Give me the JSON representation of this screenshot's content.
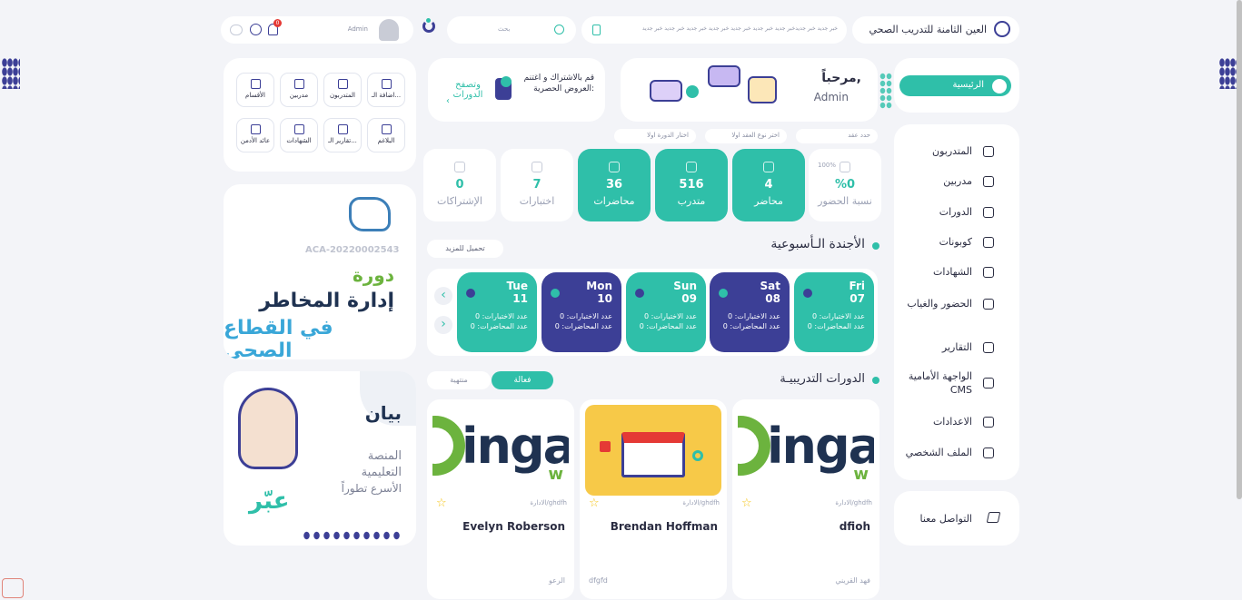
{
  "header": {
    "brand": "العين الثامنة للتدريب الصحي",
    "ticker": "خبر جديد خبر جديدخبر جديد خبر جديد خبر جديد خبر جديد خبر جديد خبر جديد خبر جديد",
    "search_placeholder": "بحث",
    "user": "Admin",
    "notif_count": "0"
  },
  "sidebar": {
    "home": "الرئيسية",
    "items": [
      {
        "label": "المتدربون",
        "icon": "user-circle-icon"
      },
      {
        "label": "مدربين",
        "icon": "id-card-icon"
      },
      {
        "label": "الدورات",
        "icon": "graduation-cap-icon"
      },
      {
        "label": "كوبونات",
        "icon": "barcode-icon"
      },
      {
        "label": "الشهادات",
        "icon": "medal-icon"
      },
      {
        "label": "الحضور والغياب",
        "icon": "calendar-icon"
      },
      {
        "label": "التقارير",
        "icon": "chart-doc-icon"
      },
      {
        "label": "الواجهة الأمامية CMS",
        "icon": "monitor-icon"
      },
      {
        "label": "الاعدادات",
        "icon": "gear-icon"
      },
      {
        "label": "الملف الشخصي",
        "icon": "profile-icon"
      }
    ],
    "contact": "التواصل معنا"
  },
  "welcome": {
    "greeting": "مرحباً,",
    "name": "Admin"
  },
  "promo": {
    "text": "قم بالاشتراك و اغتنم العروض الحصرية:",
    "link": "وتصفح الدورات"
  },
  "quick_actions": [
    {
      "label": "اضافة الـ..."
    },
    {
      "label": "المتدربون"
    },
    {
      "label": "مدربين"
    },
    {
      "label": "الأقسام"
    },
    {
      "label": "البلاغم"
    },
    {
      "label": "تقارير الـ..."
    },
    {
      "label": "الشهادات"
    },
    {
      "label": "عائد الأدمن"
    }
  ],
  "filters": [
    "حدد عقد",
    "اختر نوع العقد اولا",
    "اختار الدورة اولا"
  ],
  "stats": [
    {
      "value": "%0",
      "label": "نسبة الحضور",
      "pct": "100%"
    },
    {
      "value": "4",
      "label": "محاضر"
    },
    {
      "value": "516",
      "label": "متدرب"
    },
    {
      "value": "36",
      "label": "محاضرات"
    },
    {
      "value": "7",
      "label": "اختبارات"
    },
    {
      "value": "0",
      "label": "الإشتراكات"
    }
  ],
  "agenda": {
    "title": "الأجندة الـأسبوعية",
    "load_more": "تحميل للمزيد",
    "days": [
      {
        "name": "Fri",
        "date": "07",
        "exams": "عدد الاختبارات: 0",
        "lectures": "عدد المحاضرات: 0"
      },
      {
        "name": "Sat",
        "date": "08",
        "exams": "عدد الاختبارات: 0",
        "lectures": "عدد المحاضرات: 0"
      },
      {
        "name": "Sun",
        "date": "09",
        "exams": "عدد الاختبارات: 0",
        "lectures": "عدد المحاضرات: 0"
      },
      {
        "name": "Mon",
        "date": "10",
        "exams": "عدد الاختبارات: 0",
        "lectures": "عدد المحاضرات: 0"
      },
      {
        "name": "Tue",
        "date": "11",
        "exams": "عدد الاختبارات: 0",
        "lectures": "عدد المحاضرات: 0"
      }
    ]
  },
  "courses": {
    "title": "الدورات التدريبيـة",
    "tab_active": "فعالة",
    "tab_ended": "منتهية",
    "items": [
      {
        "category": "الادارة/ghdfh",
        "name": "dfioh",
        "instructor": "فهد القريني",
        "extra": ""
      },
      {
        "category": "الادارة/ghdfh",
        "name": "Brendan Hoffman",
        "instructor": "",
        "extra": "dfgfd"
      },
      {
        "category": "الادارة/ghdfh",
        "name": "Evelyn Roberson",
        "instructor": "الرعو",
        "extra": ""
      }
    ],
    "logo_text": "inga",
    "logo_sub": "w"
  },
  "banner1": {
    "code": "ACA-20220002543",
    "line1": "دورة",
    "line2": "إدارة المخاطر",
    "line3": "في القطاع الصحي"
  },
  "banner2": {
    "brand": "بيان",
    "line1": "المنصة",
    "line2": "التعليمية",
    "line3": "الأسرع تطوراً",
    "tag": "عبّر"
  }
}
